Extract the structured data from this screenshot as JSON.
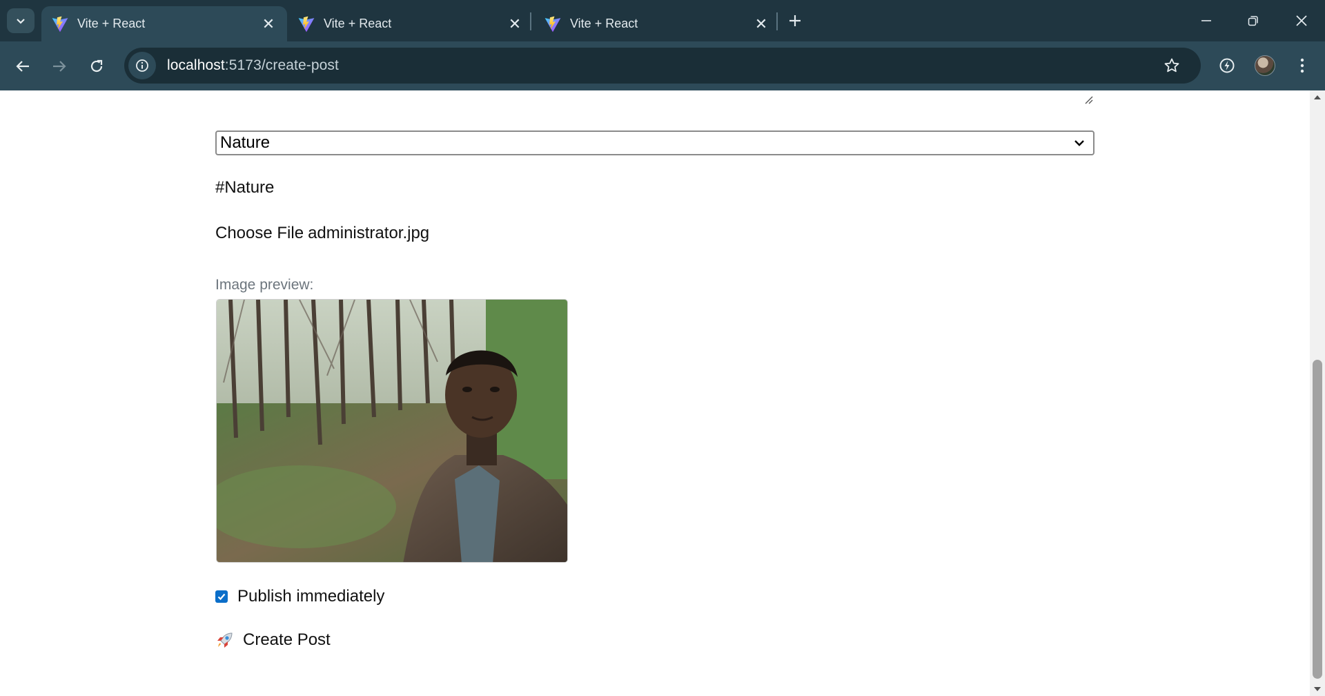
{
  "browser": {
    "tabs": [
      {
        "title": "Vite + React",
        "active": true
      },
      {
        "title": "Vite + React",
        "active": false
      },
      {
        "title": "Vite + React",
        "active": false
      }
    ],
    "url_host": "localhost",
    "url_path": ":5173/create-post",
    "icons": {
      "tab_search": "chevron-down-icon",
      "back": "arrow-left-icon",
      "forward": "arrow-right-icon",
      "reload": "reload-icon",
      "site_info": "info-icon",
      "bookmark": "star-icon",
      "extension": "extension-icon",
      "menu": "kebab-menu-icon"
    }
  },
  "form": {
    "category_selected": "Nature",
    "hashtag": "#Nature",
    "file_button": "Choose File",
    "file_name": "administrator.jpg",
    "preview_label": "Image preview:",
    "publish_label": "Publish immediately",
    "publish_checked": true,
    "submit_label": "Create Post",
    "submit_icon": "rocket-icon"
  },
  "colors": {
    "tabbar_bg": "#1f3540",
    "toolbar_bg": "#2d4a58",
    "checkbox_accent": "#0b6ec9",
    "preview_label": "#6c757d"
  }
}
